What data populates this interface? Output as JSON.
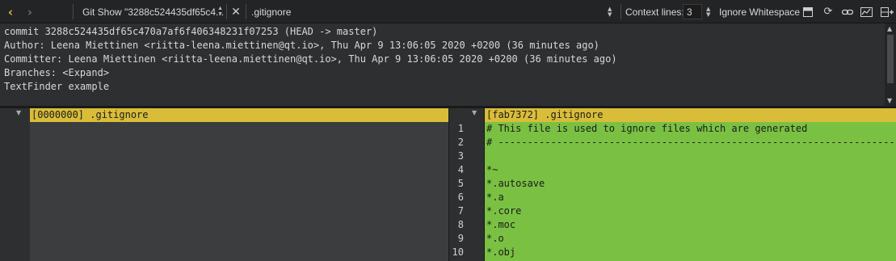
{
  "toolbar": {
    "back_icon": "chevron-left-icon",
    "forward_icon": "chevron-right-icon",
    "document_title": "Git Show \"3288c524435df65c4...",
    "file_name": ".gitignore",
    "context_lines_label": "Context lines:",
    "context_lines_value": "3",
    "ignore_whitespace_label": "Ignore Whitespace"
  },
  "description": {
    "lines": [
      "commit 3288c524435df65c470a7af6f406348231f07253 (HEAD -> master)",
      "Author: Leena Miettinen <riitta-leena.miettinen@qt.io>, Thu Apr 9 13:06:05 2020 +0200 (36 minutes ago)",
      "Committer: Leena Miettinen <riitta-leena.miettinen@qt.io>, Thu Apr 9 13:06:05 2020 +0200 (36 minutes ago)",
      "Branches: <Expand>",
      "",
      "TextFinder example"
    ]
  },
  "left_pane": {
    "header": "[0000000] .gitignore"
  },
  "right_pane": {
    "header": "[fab7372] .gitignore",
    "line_numbers": [
      "1",
      "2",
      "3",
      "4",
      "5",
      "6",
      "7",
      "8",
      "9",
      "10"
    ],
    "lines": [
      "# This file is used to ignore files which are generated",
      "# ----------------------------------------------------------------------",
      "",
      "*~",
      "*.autosave",
      "*.a",
      "*.core",
      "*.moc",
      "*.o",
      "*.obj"
    ]
  },
  "colors": {
    "added_bg": "#7ac143",
    "header_bg": "#d9bd39",
    "toolbar_bg": "#232425",
    "accent": "#e0b93a"
  }
}
